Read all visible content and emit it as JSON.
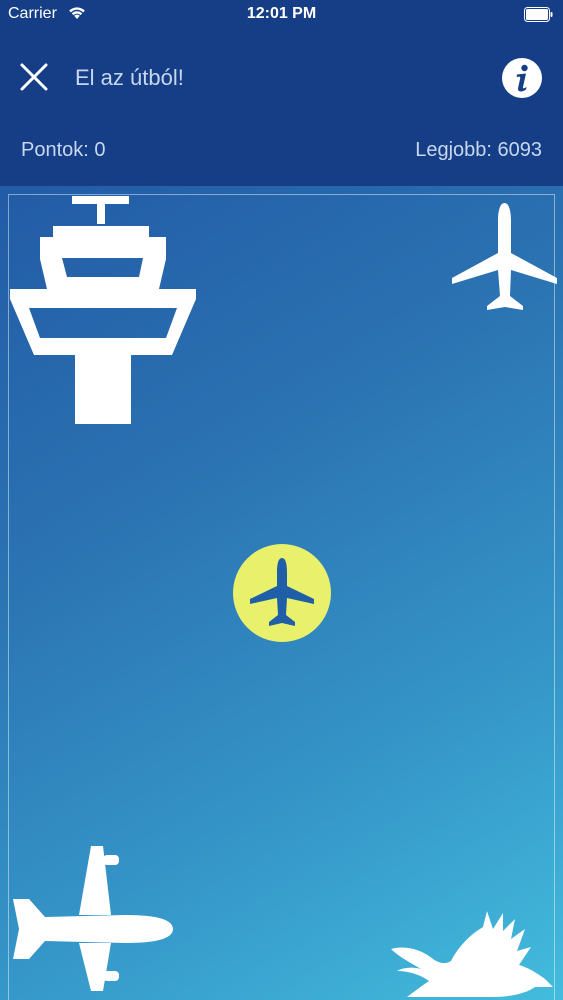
{
  "status": {
    "carrier": "Carrier",
    "time": "12:01 PM",
    "wifi_icon": "wifi-icon",
    "battery_icon": "battery-full-icon"
  },
  "header": {
    "title": "El az útból!",
    "close_icon": "close-icon",
    "info_icon": "info-icon",
    "background_color": "#163e86",
    "text_color": "#c7d7ee"
  },
  "scoreboard": {
    "score_label": "Pontok: 0",
    "best_label": "Legjobb: 6093"
  },
  "game": {
    "background_gradient": [
      "#225ba6",
      "#43bcdd"
    ],
    "player_color": "#e9f06c",
    "sprites": [
      "control-tower-icon",
      "airplane-icon",
      "player-airplane-icon",
      "bird-icon"
    ]
  }
}
